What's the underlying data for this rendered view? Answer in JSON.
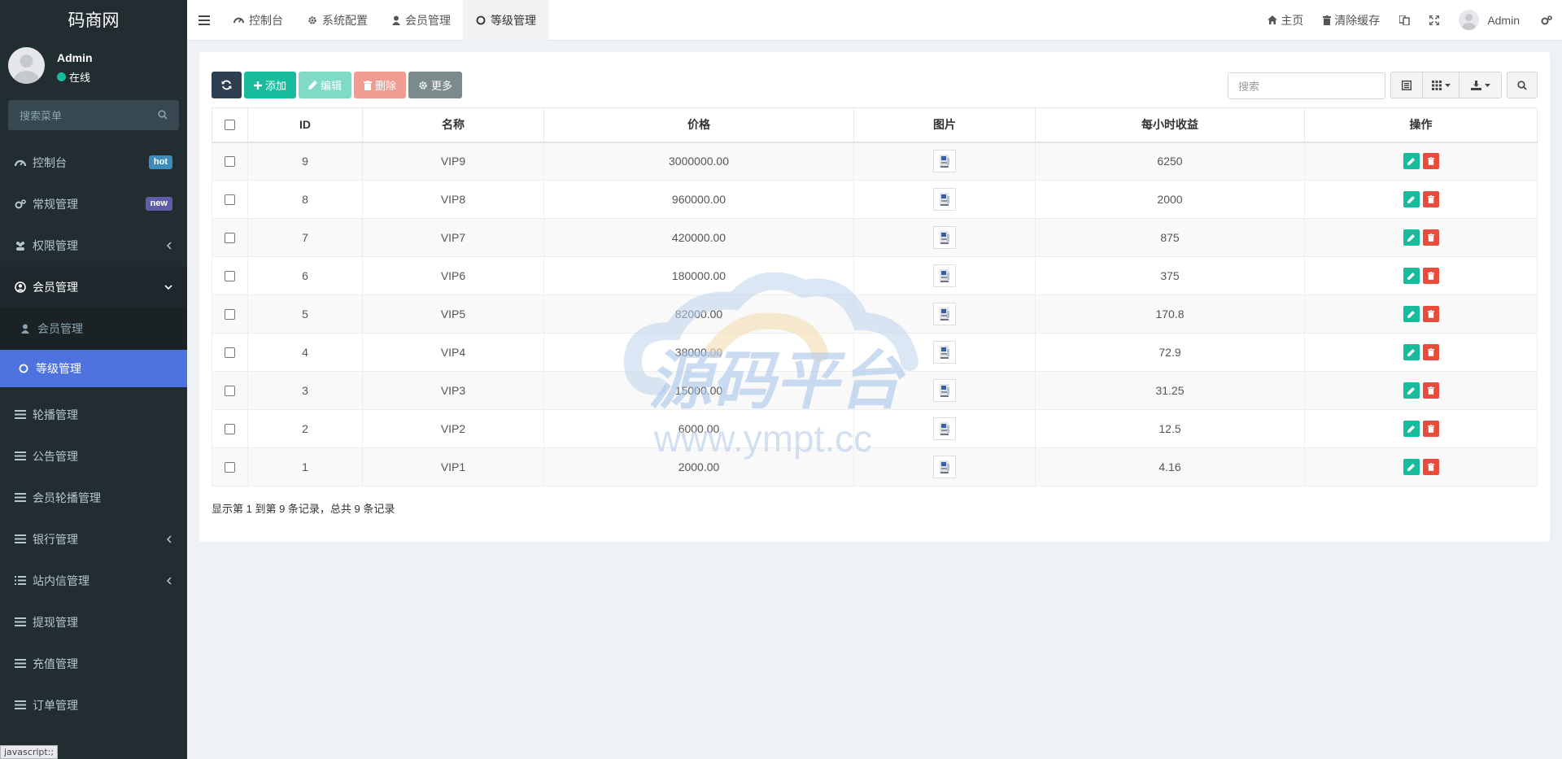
{
  "sidebar": {
    "logo": "码商网",
    "user": {
      "name": "Admin",
      "status": "在线"
    },
    "search_placeholder": "搜索菜单",
    "menu": [
      {
        "label": "控制台",
        "badge": "hot"
      },
      {
        "label": "常规管理",
        "badge": "new"
      },
      {
        "label": "权限管理"
      },
      {
        "label": "会员管理"
      },
      {
        "label": "会员管理"
      },
      {
        "label": "等级管理"
      },
      {
        "label": "轮播管理"
      },
      {
        "label": "公告管理"
      },
      {
        "label": "会员轮播管理"
      },
      {
        "label": "银行管理"
      },
      {
        "label": "站内信管理"
      },
      {
        "label": "提现管理"
      },
      {
        "label": "充值管理"
      },
      {
        "label": "订单管理"
      }
    ],
    "status_bar": "javascript:;"
  },
  "header": {
    "tabs": [
      "控制台",
      "系统配置",
      "会员管理",
      "等级管理"
    ],
    "home": "主页",
    "clear_cache": "清除缓存",
    "user": "Admin"
  },
  "toolbar": {
    "add": "添加",
    "edit": "编辑",
    "delete": "删除",
    "more": "更多",
    "search_placeholder": "搜索"
  },
  "table": {
    "headers": [
      "ID",
      "名称",
      "价格",
      "图片",
      "每小时收益",
      "操作"
    ],
    "rows": [
      {
        "id": "9",
        "name": "VIP9",
        "price": "3000000.00",
        "income": "6250"
      },
      {
        "id": "8",
        "name": "VIP8",
        "price": "960000.00",
        "income": "2000"
      },
      {
        "id": "7",
        "name": "VIP7",
        "price": "420000.00",
        "income": "875"
      },
      {
        "id": "6",
        "name": "VIP6",
        "price": "180000.00",
        "income": "375"
      },
      {
        "id": "5",
        "name": "VIP5",
        "price": "82000.00",
        "income": "170.8"
      },
      {
        "id": "4",
        "name": "VIP4",
        "price": "38000.00",
        "income": "72.9"
      },
      {
        "id": "3",
        "name": "VIP3",
        "price": "15000.00",
        "income": "31.25"
      },
      {
        "id": "2",
        "name": "VIP2",
        "price": "6000.00",
        "income": "12.5"
      },
      {
        "id": "1",
        "name": "VIP1",
        "price": "2000.00",
        "income": "4.16"
      }
    ]
  },
  "pager_info": "显示第 1 到第 9 条记录，总共 9 条记录",
  "watermark": {
    "title": "源码平台",
    "url": "www.ympt.cc"
  },
  "colors": {
    "sidebar": "#222d32",
    "accent": "#4e73df",
    "success": "#18bc9c",
    "danger": "#e74c3c"
  }
}
